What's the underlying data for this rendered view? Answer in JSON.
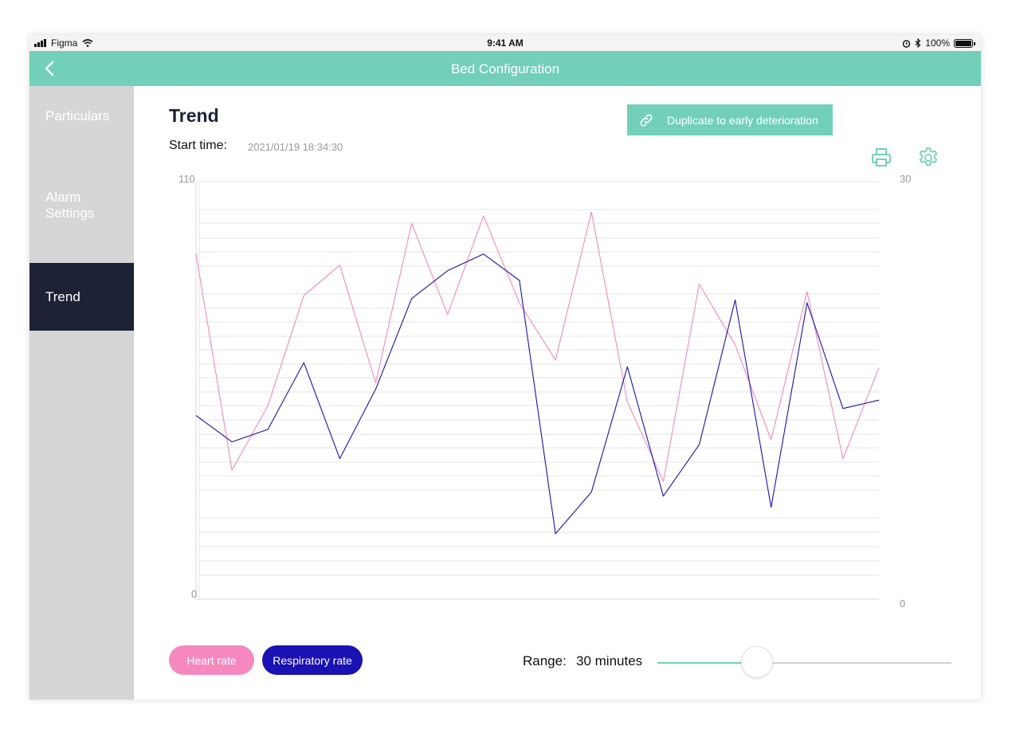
{
  "status_bar": {
    "carrier": "Figma",
    "time": "9:41 AM",
    "battery": "100%"
  },
  "header": {
    "title": "Bed Configuration"
  },
  "sidebar": {
    "items": [
      {
        "label": "Particulars"
      },
      {
        "label": "Alarm\nSettings"
      },
      {
        "label": "Trend"
      }
    ],
    "active_index": 2
  },
  "main": {
    "title": "Trend",
    "start_time_label": "Start time:",
    "start_time_value": "2021/01/19 18:34:30",
    "duplicate_button": "Duplicate to early deterioration"
  },
  "legend": {
    "heart_rate": "Heart rate",
    "respiratory_rate": "Respiratory rate"
  },
  "range": {
    "label": "Range:",
    "value": "30 minutes",
    "slider_fraction": 0.34
  },
  "colors": {
    "accent": "#73d0b8",
    "heart_rate": "#f589bf",
    "respiratory_rate": "#1b12b3",
    "nav_active": "#1d2236"
  },
  "chart_data": {
    "type": "line",
    "y_left": {
      "min": 0,
      "max": 110,
      "tick_labels": [
        "110",
        "0"
      ]
    },
    "y_right": {
      "min": 0,
      "max": 30,
      "tick_labels": [
        "30",
        "0"
      ]
    },
    "grid": true,
    "series": [
      {
        "name": "Heart rate",
        "axis": "left",
        "values": [
          91,
          34,
          51,
          80,
          88,
          57,
          99,
          75,
          101,
          78,
          63,
          102,
          52,
          31,
          83,
          67,
          42,
          81,
          37,
          61
        ]
      },
      {
        "name": "Respiratory rate",
        "axis": "right",
        "values": [
          13.2,
          11.3,
          12.2,
          17.0,
          10.1,
          15.1,
          21.6,
          23.6,
          24.8,
          22.9,
          4.7,
          7.7,
          16.7,
          7.4,
          11.1,
          21.5,
          6.6,
          21.3,
          13.7,
          14.3
        ]
      }
    ]
  }
}
